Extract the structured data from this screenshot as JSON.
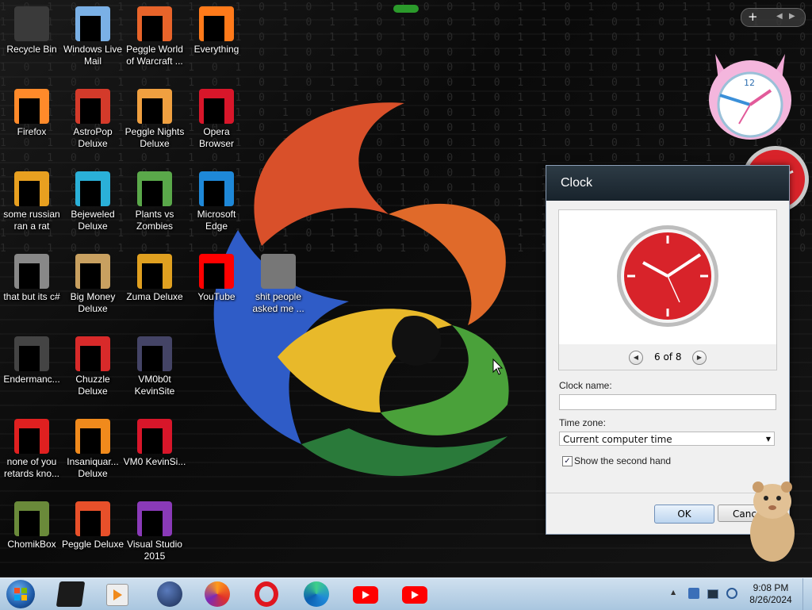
{
  "desktop_icons": [
    {
      "label": "Recycle Bin"
    },
    {
      "label": "Windows Live Mail"
    },
    {
      "label": "Peggle World of Warcraft ..."
    },
    {
      "label": "Everything"
    },
    {
      "label": "Firefox"
    },
    {
      "label": "AstroPop Deluxe"
    },
    {
      "label": "Peggle Nights Deluxe"
    },
    {
      "label": "Opera Browser"
    },
    {
      "label": "some russian ran a rat"
    },
    {
      "label": "Bejeweled Deluxe"
    },
    {
      "label": "Plants vs Zombies"
    },
    {
      "label": "Microsoft Edge"
    },
    {
      "label": "that but its c#"
    },
    {
      "label": "Big Money Deluxe"
    },
    {
      "label": "Zuma Deluxe"
    },
    {
      "label": "YouTube"
    },
    {
      "label": "shit people asked me ..."
    },
    {
      "label": "Endermanc..."
    },
    {
      "label": "Chuzzle Deluxe"
    },
    {
      "label": "VM0b0t KevinSite"
    },
    {
      "label": "none of you retards kno..."
    },
    {
      "label": "Insaniquar... Deluxe"
    },
    {
      "label": "VM0 KevinSi..."
    },
    {
      "label": "ChomikBox"
    },
    {
      "label": "Peggle Deluxe"
    },
    {
      "label": "Visual Studio 2015"
    }
  ],
  "background_digits": "1 0 1 0 0 1 0 1 1 0 1 0 1 0 1 1 0 1 0 0 1 0 1 1 0 1 0 1 0 1 1 0 1 0 0 1 0 1 1 0 1 0 1 0",
  "sidebar_gadget": {
    "add_label": "+"
  },
  "dialog": {
    "title": "Clock",
    "pager": "6 of 8",
    "clock_name_label": "Clock name:",
    "clock_name_value": "",
    "time_zone_label": "Time zone:",
    "time_zone_value": "Current computer time",
    "second_hand_label": "Show the second hand",
    "ok_label": "OK",
    "cancel_label": "Canc"
  },
  "taskbar": {
    "time": "9:08 PM",
    "date": "8/26/2024",
    "tray_chevron": "▲"
  },
  "colors": {
    "clock_red": "#d8232a",
    "taskbar": "#b9d1e8",
    "youtube": "#ff0000",
    "opera": "#e0161f"
  }
}
